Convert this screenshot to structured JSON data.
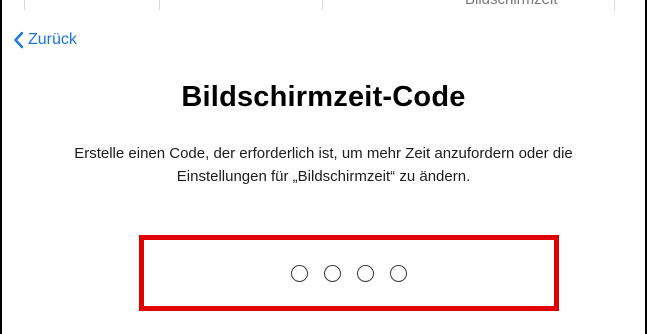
{
  "top_strip": {
    "partial_text": "Bildschirmzeit"
  },
  "navigation": {
    "back_label": "Zurück",
    "back_icon": "chevron-left-icon"
  },
  "screen": {
    "title": "Bildschirmzeit-Code",
    "description_line1": "Erstelle einen Code, der erforderlich ist, um mehr Zeit anzufordern oder die",
    "description_line2": "Einstellungen für „Bildschirmzeit“ zu ändern."
  },
  "passcode": {
    "digits_total": 4,
    "digits_filled": 0
  },
  "colors": {
    "accent": "#1a73e8",
    "highlight": "#e00000"
  }
}
